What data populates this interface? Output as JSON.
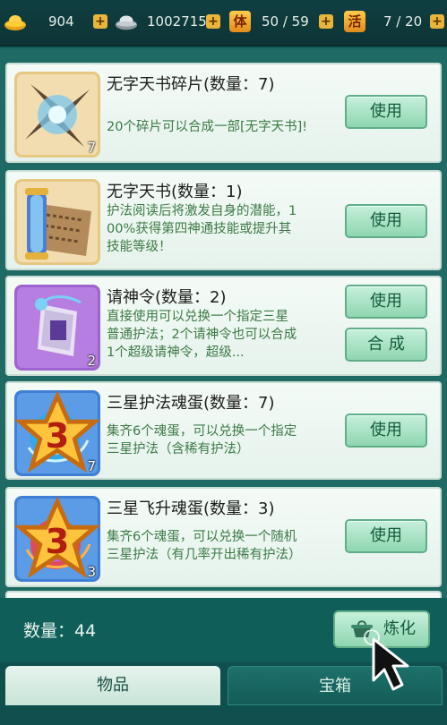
{
  "resources": {
    "gold": "904",
    "silver": "1002715",
    "stamina_char": "体",
    "stamina": "50 / 59",
    "activity_char": "活",
    "activity": "7 / 20"
  },
  "items": [
    {
      "title": "无字天书碎片(数量：7)",
      "desc_lines": [
        "20个碎片可以合成一部[无字天书]!"
      ],
      "count": "7",
      "buttons": [
        "使用"
      ]
    },
    {
      "title": "无字天书(数量：1)",
      "desc_lines": [
        "护法阅读后将激发自身的潜能，1",
        "00%获得第四神通技能或提升其",
        "技能等级！"
      ],
      "count": "",
      "buttons": [
        "使用"
      ]
    },
    {
      "title": "请神令(数量：2)",
      "desc_lines": [
        "直接使用可以兑换一个指定三星",
        "普通护法；2个请神令也可以合成",
        "1个超级请神令，超级..."
      ],
      "count": "2",
      "buttons": [
        "使用",
        "合 成"
      ]
    },
    {
      "title": "三星护法魂蛋(数量：7)",
      "desc_lines": [
        "集齐6个魂蛋，可以兑换一个指定",
        "三星护法（含稀有护法）"
      ],
      "count": "7",
      "star": "3",
      "buttons": [
        "使用"
      ]
    },
    {
      "title": "三星飞升魂蛋(数量：3)",
      "desc_lines": [
        "集齐6个魂蛋，可以兑换一个随机",
        "三星护法（有几率开出稀有护法）"
      ],
      "count": "3",
      "star": "3",
      "buttons": [
        "使用"
      ]
    }
  ],
  "footer": {
    "quantity": "数量：44",
    "refine_button": "炼化"
  },
  "tabs": {
    "items": "物品",
    "chest": "宝箱"
  },
  "colors": {
    "background": "#1f6a64",
    "button_green": "#8fd6b1",
    "desc_green": "#3c7a45"
  }
}
